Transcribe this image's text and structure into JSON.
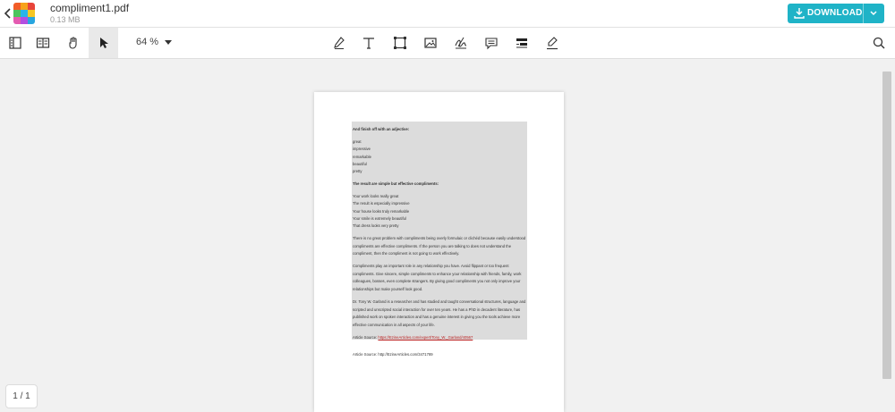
{
  "file": {
    "name": "compliment1.pdf",
    "size": "0.13 MB"
  },
  "header": {
    "download_label": "DOWNLOAD"
  },
  "colors": {
    "accent": "#1fb3c7",
    "logo": [
      "#f25c27",
      "#f7a21b",
      "#e8443a",
      "#4cc45e",
      "#2ab4e8",
      "#f6c624",
      "#e45bb1",
      "#b24ee0",
      "#28a6e0"
    ]
  },
  "toolbar": {
    "zoom": "64 %",
    "left_tools": [
      "thumbnails-icon",
      "reader-icon",
      "hand-icon",
      "pointer-icon"
    ],
    "center_tools": [
      "pen-icon",
      "text-icon",
      "shape-icon",
      "image-icon",
      "signature-icon",
      "comment-icon",
      "redact-icon",
      "highlight-icon"
    ]
  },
  "document": {
    "heading1": "And finish off with an adjective:",
    "adjectives": [
      "great",
      "impressive",
      "remarkable",
      "beautiful",
      "pretty"
    ],
    "heading2": "The result are simple but effective compliments:",
    "examples": [
      "Your work looks really great",
      "The result is especially impressive",
      "Your house looks truly remarkable",
      "Your smile is extremely beautiful",
      "That dress looks very pretty"
    ],
    "para1": "There is no great problem with compliments being overly formulaic or clichéd because easily understood compliments are effective compliments. If the person you are talking to does not understand the compliment, then the compliment is not going to work effectively.",
    "para2": "Compliments play an important role in any relationship you have. Avoid flippant or too frequent compliments. Give sincere, simple compliments to enhance your relationship with friends, family, work colleagues, bosses, even complete strangers. By giving good compliments you not only improve your relationships but make yourself look good.",
    "para3": "Dr. Tony W. Garland is a researcher and has studied and taught conversational structures, language and scripted and unscripted social interaction for over ten years. He has a PhD in decadent literature, has published work on spoken interaction and has a genuine interest in giving you the tools achieve more effective communication in all aspects of your life.",
    "source1_label": "Article Source:",
    "source1_link": "https://EzineArticles.com/expert/Tony_W._Garland/40567",
    "source2": "Article Source: http://EzineArticles.com/3471789"
  },
  "pager": {
    "label": "1 / 1"
  }
}
